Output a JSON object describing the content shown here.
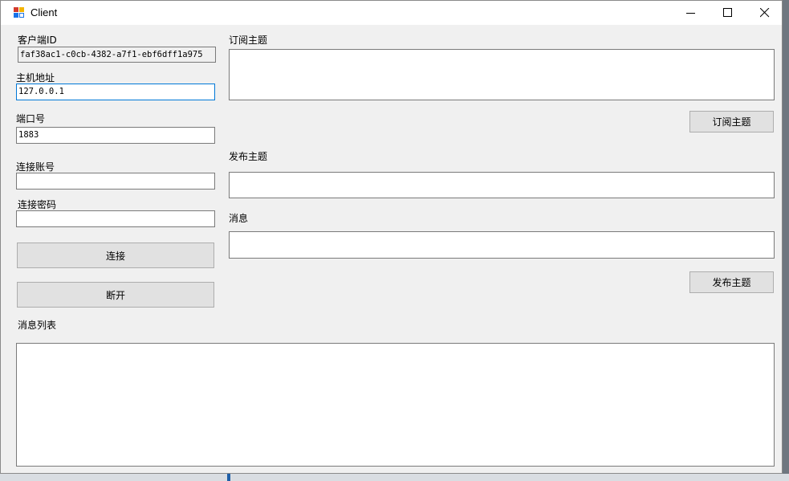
{
  "window": {
    "title": "Client"
  },
  "titlebar_controls": {
    "minimize_icon": "minimize-icon",
    "maximize_icon": "maximize-icon",
    "close_icon": "close-icon"
  },
  "connection": {
    "client_id_label": "客户端ID",
    "client_id_value": "faf38ac1-c0cb-4382-a7f1-ebf6dff1a975",
    "host_label": "主机地址",
    "host_value": "127.0.0.1",
    "port_label": "端口号",
    "port_value": "1883",
    "username_label": "连接账号",
    "username_value": "",
    "password_label": "连接密码",
    "password_value": "",
    "connect_button": "连接",
    "disconnect_button": "断开"
  },
  "subscribe": {
    "topic_label": "订阅主题",
    "topic_value": "",
    "subscribe_button": "订阅主题"
  },
  "publish": {
    "topic_label": "发布主题",
    "topic_value": "",
    "message_label": "消息",
    "message_value": "",
    "publish_button": "发布主题"
  },
  "messages": {
    "list_label": "消息列表",
    "content": ""
  },
  "colors": {
    "focus_border": "#0078d7",
    "window_bg": "#f0f0f0",
    "button_bg": "#e1e1e1"
  }
}
